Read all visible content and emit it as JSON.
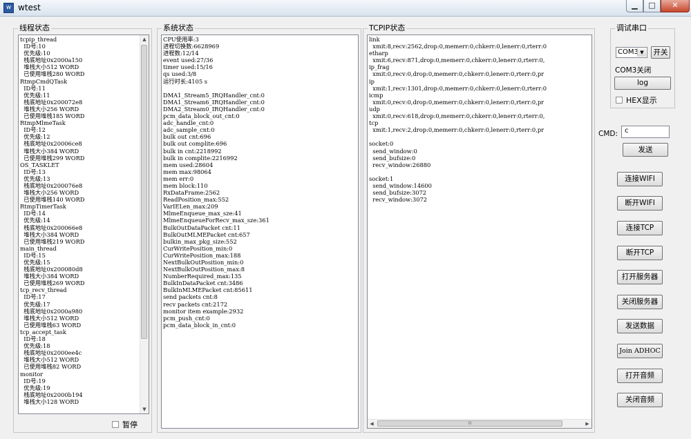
{
  "window": {
    "title": "wtest",
    "app_icon": "app-icon"
  },
  "thread_panel": {
    "title": "线程状态",
    "lines": [
      "tcpip_thread",
      "  ID号:10",
      "  优先级:10",
      "  栈底地址0x2000a150",
      "  堆栈大小512 WORD",
      "  已使用堆栈280 WORD",
      "RtmpCmdQTask",
      "  ID号:11",
      "  优先级:11",
      "  栈底地址0x200072e8",
      "  堆栈大小256 WORD",
      "  已使用堆栈185 WORD",
      "RtmpMlmeTask",
      "  ID号:12",
      "  优先级:12",
      "  栈底地址0x20006ce8",
      "  堆栈大小384 WORD",
      "  已使用堆栈299 WORD",
      "OS_TASKLET",
      "  ID号:13",
      "  优先级:13",
      "  栈底地址0x200076e8",
      "  堆栈大小256 WORD",
      "  已使用堆栈140 WORD",
      "RtmpTimerTask",
      "  ID号:14",
      "  优先级:14",
      "  栈底地址0x200066e8",
      "  堆栈大小384 WORD",
      "  已使用堆栈219 WORD",
      "main_thread",
      "  ID号:15",
      "  优先级:15",
      "  栈底地址0x200080d8",
      "  堆栈大小384 WORD",
      "  已使用堆栈269 WORD",
      "tcp_recv_thread",
      "  ID号:17",
      "  优先级:17",
      "  栈底地址0x2000a980",
      "  堆栈大小512 WORD",
      "  已使用堆栈63 WORD",
      "tcp_accept_task",
      "  ID号:18",
      "  优先级:18",
      "  栈底地址0x2000ee4c",
      "  堆栈大小512 WORD",
      "  已使用堆栈82 WORD",
      "monitor",
      "  ID号:19",
      "  优先级:19",
      "  栈底地址0x2000b194",
      "  堆栈大小128 WORD"
    ],
    "pause_label": "暂停"
  },
  "system_panel": {
    "title": "系统状态",
    "lines": [
      "CPU使用率:3",
      "进程切换数:6628969",
      "进程数:12/14",
      "event used:27/36",
      "timer used:15/16",
      "qs used:3/8",
      "运行时长:4105 s",
      "",
      "DMA1_Stream5_IRQHandler_cnt:0",
      "DMA1_Stream6_IRQHandler_cnt:0",
      "DMA2_Stream0_IRQHandler_cnt:0",
      "pcm_data_block_out_cnt:0",
      "adc_handle_cnt:0",
      "adc_sample_cnt:0",
      "bulk out cnt:696",
      "bulk out complite:696",
      "bulk in cnt:2218992",
      "bulk in complite:2216992",
      "mem used:28604",
      "mem max:98064",
      "mem err:0",
      "mem block:110",
      "RxDataFrame:2562",
      "ReadPosition_max:552",
      "VarIELen_max:209",
      "MlmeEnqueue_max_sze:41",
      "MlmeEnqueueForRecv_max_sze:361",
      "BulkOutDataPacket cnt:11",
      "BulkOutMLMEPacket cnt:657",
      "bulkin_max_pkg_size:552",
      "CurWritePosition_min:0",
      "CurWritePosition_max:188",
      "NextBulkOutPosition_min:0",
      "NextBulkOutPosition_max:8",
      "NumberRequired_max:135",
      "BulkInDataPacket cnt:3486",
      "BulkInMLMEPacket cnt:85611",
      "send packets cnt:8",
      "recv packets cnt:2172",
      "monitor item example:2932",
      "pcm_push_cnt:0",
      "pcm_data_block_in_cnt:0"
    ]
  },
  "tcpip_panel": {
    "title": "TCPIP状态",
    "lines": [
      "link",
      "  xmit:8,recv:2562,drop:0,memerr:0,chkerr:0,lenerr:0,rterr:0",
      "etharp",
      "  xmit:6,recv:871,drop:0,memerr:0,chkerr:0,lenerr:0,rterr:0,",
      "ip_frag",
      "  xmit:0,recv:0,drop:0,memerr:0,chkerr:0,lenerr:0,rterr:0,pr",
      "ip",
      "  xmit:1,recv:1301,drop:0,memerr:0,chkerr:0,lenerr:0,rterr:0",
      "icmp",
      "  xmit:0,recv:0,drop:0,memerr:0,chkerr:0,lenerr:0,rterr:0,pr",
      "udp",
      "  xmit:0,recv:618,drop:0,memerr:0,chkerr:0,lenerr:0,rterr:0,",
      "tcp",
      "  xmit:1,recv:2,drop:0,memerr:0,chkerr:0,lenerr:0,rterr:0,pr",
      "",
      "socket:0",
      "  send_window:0",
      "  send_bufsize:0",
      "  recv_window:26880",
      "",
      "socket:1",
      "  send_window:14600",
      "  send_bufsize:3072",
      "  recv_window:3072"
    ],
    "hscroll_grip": "III"
  },
  "serial_panel": {
    "title": "调试串口",
    "port_value": "COM3",
    "open_label": "开关",
    "status_text": "COM3关闭",
    "log_label": "log",
    "hex_label": "HEX显示"
  },
  "cmd": {
    "label": "CMD:",
    "value": "c",
    "send_label": "发送"
  },
  "actions": {
    "connect_wifi": "连接WIFI",
    "disconnect_wifi": "断开WIFI",
    "connect_tcp": "连接TCP",
    "disconnect_tcp": "断开TCP",
    "start_server": "打开服务器",
    "stop_server": "关闭服务器",
    "send_data": "发送数据",
    "join_adhoc": "Join ADHOC",
    "open_audio": "打开音频",
    "close_audio": "关闭音频"
  }
}
